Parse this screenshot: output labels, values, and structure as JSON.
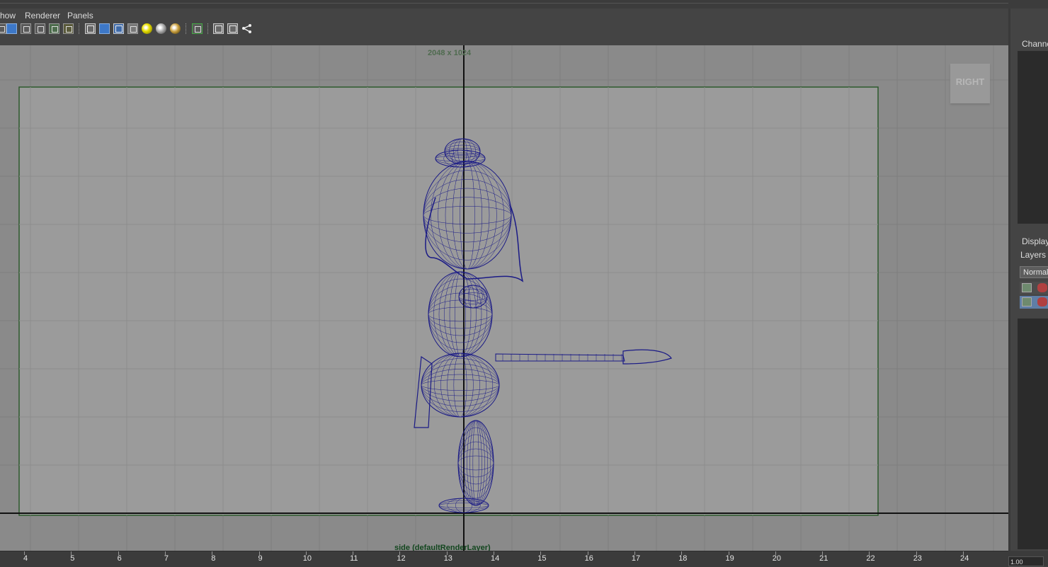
{
  "menu": {
    "show_label": "how",
    "renderer_label": "Renderer",
    "panels_label": "Panels"
  },
  "toolbar": {
    "icons": [
      "wireframe-icon",
      "shaded-icon",
      "smooth-shade-icon",
      "bounding-box-icon",
      "texture-icon",
      "text-icon",
      "isolate-icon",
      "default-material-icon",
      "xray-icon",
      "checker-icon",
      "light-icon",
      "lambert-sphere-icon",
      "gold-sphere-icon",
      "select-camera-icon",
      "frame-all-icon",
      "frame-selected-icon",
      "hierarchy-icon"
    ]
  },
  "viewport": {
    "resolution_label": "2048 x 1024",
    "camera_label": "side (defaultRenderLayer)",
    "view_cube_label": "RIGHT",
    "wire_color": "#1a1a86",
    "gate_color": "#2c5a2c"
  },
  "side_panel": {
    "channel_title": "Channel",
    "display_tab": "Display",
    "layers_tab": "Layers",
    "blend_mode": "Normal"
  },
  "timeline": {
    "frames": [
      "4",
      "5",
      "6",
      "7",
      "8",
      "9",
      "10",
      "11",
      "12",
      "13",
      "14",
      "15",
      "16",
      "17",
      "18",
      "19",
      "20",
      "21",
      "22",
      "23",
      "24"
    ],
    "current_value": "1.00"
  }
}
